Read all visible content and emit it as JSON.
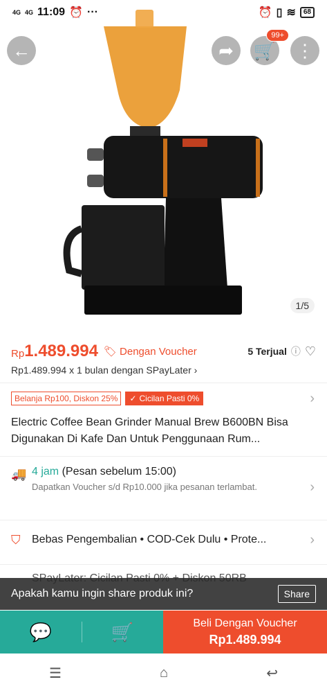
{
  "status": {
    "sig1": "4G",
    "sig2": "4G",
    "time": "11:09",
    "battery": "68"
  },
  "header": {
    "cart_badge": "99+",
    "image_counter": "1/5"
  },
  "price": {
    "currency": "Rp",
    "amount": "1.489.994",
    "voucher": "Dengan Voucher",
    "sold": "5 Terjual"
  },
  "spaylater": {
    "text": "Rp1.489.994 x 1 bulan dengan SPayLater"
  },
  "tags": {
    "promo": "Belanja Rp100, Diskon 25%",
    "cicilan": "Cicilan Pasti 0%"
  },
  "product": {
    "title": "Electric Coffee Bean Grinder Manual Brew B600BN Bisa Digunakan Di Kafe Dan Untuk Penggunaan Rum..."
  },
  "shipping": {
    "time": "4 jam",
    "note": "(Pesan sebelum 15:00)",
    "sub": "Dapatkan Voucher s/d Rp10.000 jika pesanan terlambat."
  },
  "benefits": {
    "text": "Bebas Pengembalian • COD-Cek Dulu • Prote..."
  },
  "spaylater_promo": {
    "text": "SPayLater: Cicilan Pasti 0% + Diskon 50RB"
  },
  "toast": {
    "question": "Apakah kamu ingin share produk ini?",
    "share": "Share"
  },
  "bottom": {
    "buy_line1": "Beli Dengan Voucher",
    "buy_line2": "Rp1.489.994"
  },
  "colors": {
    "accent": "#ee4d2d",
    "teal": "#26aa99"
  }
}
